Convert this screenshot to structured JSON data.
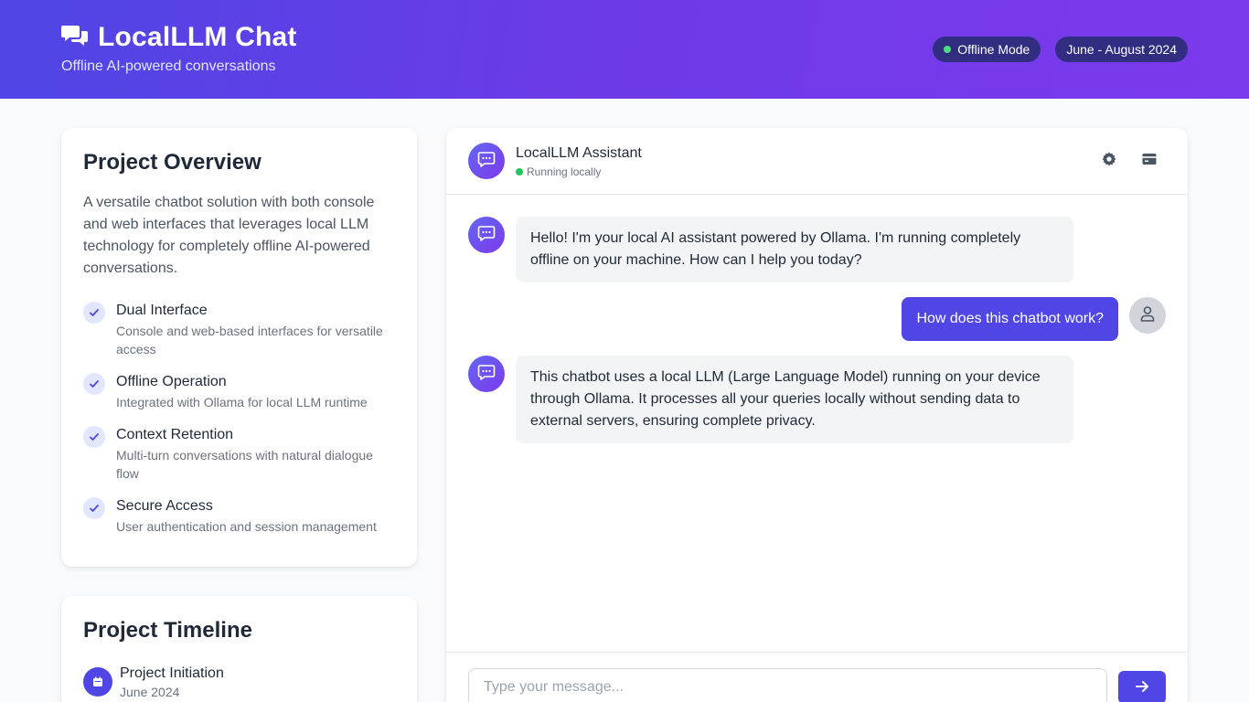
{
  "header": {
    "title": "LocalLLM Chat",
    "subtitle": "Offline AI-powered conversations",
    "status_pill": "Offline Mode",
    "date_pill": "June - August 2024"
  },
  "overview": {
    "title": "Project Overview",
    "description": "A versatile chatbot solution with both console and web interfaces that leverages local LLM technology for completely offline AI-powered conversations.",
    "features": [
      {
        "title": "Dual Interface",
        "desc": "Console and web-based interfaces for versatile access"
      },
      {
        "title": "Offline Operation",
        "desc": "Integrated with Ollama for local LLM runtime"
      },
      {
        "title": "Context Retention",
        "desc": "Multi-turn conversations with natural dialogue flow"
      },
      {
        "title": "Secure Access",
        "desc": "User authentication and session management"
      }
    ]
  },
  "timeline": {
    "title": "Project Timeline",
    "items": [
      {
        "title": "Project Initiation",
        "date": "June 2024"
      }
    ]
  },
  "chat": {
    "assistant_name": "LocalLLM Assistant",
    "assistant_status": "Running locally",
    "messages": [
      {
        "role": "assistant",
        "text": "Hello! I'm your local AI assistant powered by Ollama. I'm running completely offline on your machine. How can I help you today?"
      },
      {
        "role": "user",
        "text": "How does this chatbot work?"
      },
      {
        "role": "assistant",
        "text": "This chatbot uses a local LLM (Large Language Model) running on your device through Ollama. It processes all your queries locally without sending data to external servers, ensuring complete privacy."
      }
    ],
    "input_placeholder": "Type your message..."
  },
  "icons": {
    "brand": "comments-icon",
    "bot": "chat-bubble-icon",
    "user": "user-icon",
    "settings": "gear-icon",
    "archive": "archive-icon",
    "send": "arrow-right-icon",
    "check": "check-icon",
    "calendar": "calendar-icon"
  },
  "colors": {
    "accent": "#4f46e5",
    "accent_purple": "#7c3aed",
    "online": "#22c55e"
  }
}
